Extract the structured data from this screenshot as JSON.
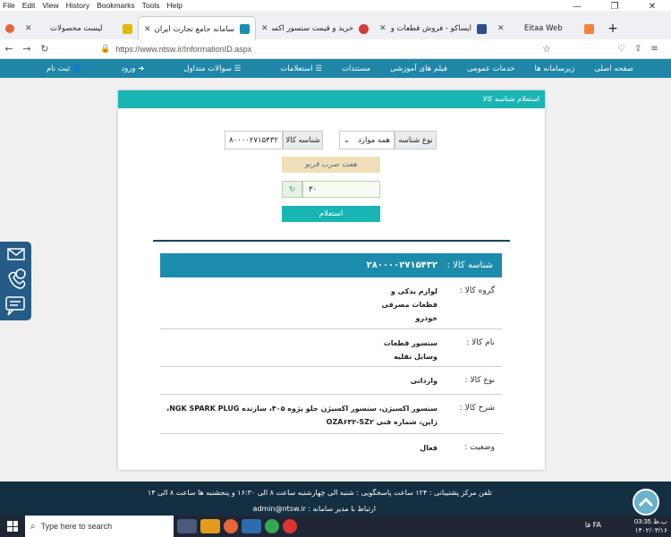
{
  "menubar": [
    "File",
    "Edit",
    "View",
    "History",
    "Bookmarks",
    "Tools",
    "Help"
  ],
  "tabs": [
    {
      "label": "لیست محصولات",
      "color": "#e6b800"
    },
    {
      "label": "سامانه جامع تجارت ایران | ntsw.ir",
      "color": "#1a8fb0",
      "active": true
    },
    {
      "label": "خرید و قیمت سنسور اکسیژن ITK",
      "color": "#d63a3a"
    },
    {
      "label": "ایساکو - فروش قطعات و خدمات",
      "color": "#2c4e8a"
    },
    {
      "label": "Eitaa Web",
      "color": "#f3833a"
    }
  ],
  "url": "https://www.ntsw.ir/InformationID.aspx",
  "sitenav": [
    "صفحه اصلی",
    "زیرسامانه ها",
    "خدمات عمومی",
    "فیلم های آموزشی",
    "مستندات",
    "استعلامات",
    "سوالات متداول",
    "ورود",
    "ثبت نام"
  ],
  "card": {
    "header": "استعلام شناسه کالا",
    "type_label": "نوع شناسه",
    "type_value": "همه موارد",
    "id_label": "شناسه کالا",
    "id_value": "۸۰۰۰۰۲۷۱۵۴۳۲",
    "captcha_text": "هفت صرب قرنو",
    "captcha_input": "۳۰",
    "submit": "استعلام"
  },
  "result": {
    "id_label": "شناسه کالا :",
    "id_value": "۲۸۰۰۰۰۲۷۱۵۴۳۲",
    "rows": [
      {
        "k": "گروه کالا :",
        "v": "لوازم یدکی و قطعات مصرفی خودرو"
      },
      {
        "k": "نام کالا :",
        "v": "سنسور قطعات وسایل نقلیه"
      },
      {
        "k": "نوع کالا :",
        "v": "وارداتی"
      },
      {
        "k": "شرح کالا :",
        "v": "سنسور اکسیژن، سنسور اکسیژن جلو پژوه ۴۰۵، سازنده NGK SPARK PLUG، ژاپن، شماره فنی OZA۶۳۲-SZ۲"
      },
      {
        "k": "وضعیت :",
        "v": "فعال"
      }
    ]
  },
  "footer": {
    "line1": "تلفن مرکز پشتیبانی :  ۱۲۴     ساعت پاسخگویی : شنبه الی چهارشنبه ساعت ۸ الی ۱۶:۳۰ و پنجشنبه ها ساعت ۸ الی ۱۴",
    "line2": "ارتباط با مدیر سامانه : admin@ntsw.ir"
  },
  "taskbar": {
    "search": "Type here to search",
    "lang": "فا FA",
    "time": "03:35 ب.ظ",
    "date": "۱۴۰۲/۰۳/۱۶"
  }
}
